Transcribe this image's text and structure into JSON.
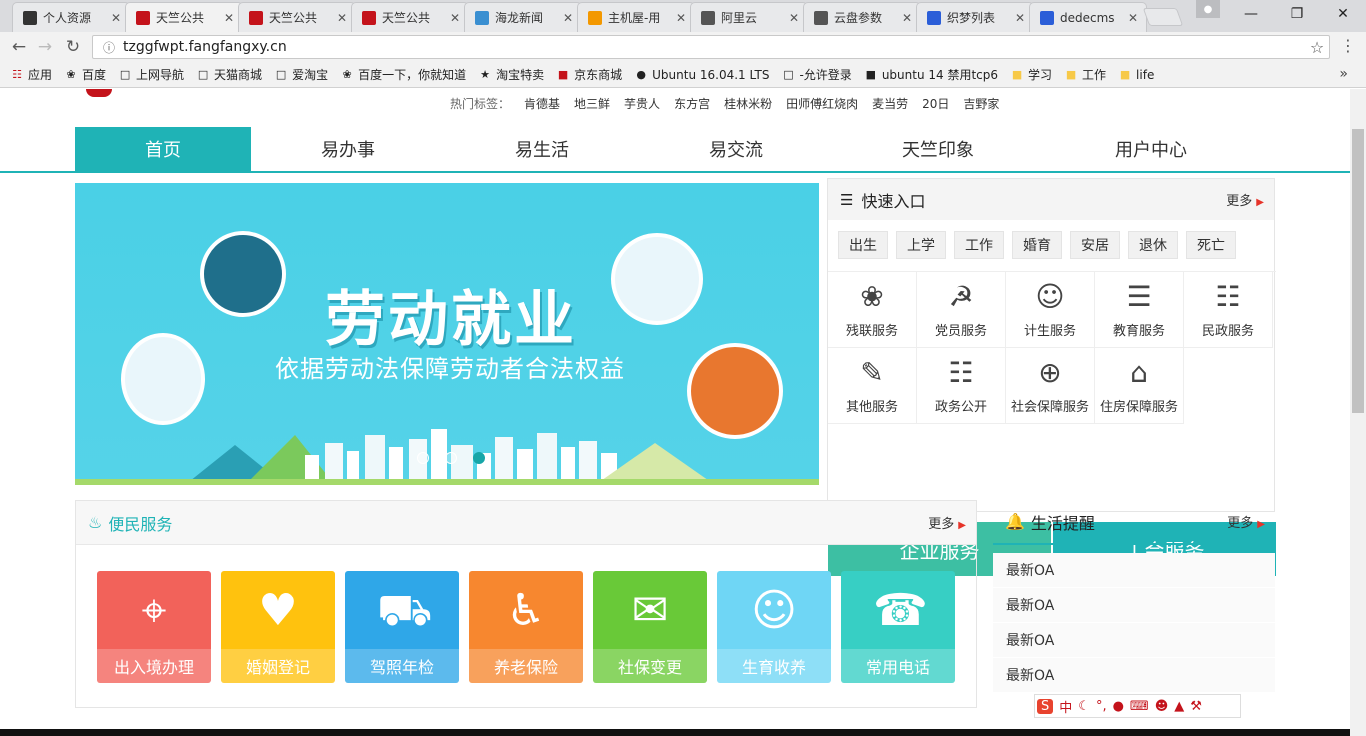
{
  "browser": {
    "tabs": [
      {
        "title": "个人资源",
        "icon": "m-icon",
        "color": "#333333"
      },
      {
        "title": "天竺公共",
        "icon": "tianzhu-icon",
        "color": "#c4131b"
      },
      {
        "title": "天竺公共",
        "icon": "tianzhu-icon",
        "color": "#c4131b"
      },
      {
        "title": "天竺公共",
        "icon": "tianzhu-icon",
        "color": "#c4131b"
      },
      {
        "title": "海龙新闻",
        "icon": "hailong-icon",
        "color": "#3a8fd1"
      },
      {
        "title": "主机屋-用",
        "icon": "house-icon",
        "color": "#f39800"
      },
      {
        "title": "阿里云",
        "icon": "cloud-icon",
        "color": "#555555"
      },
      {
        "title": "云盘参数",
        "icon": "cloud-icon",
        "color": "#555555"
      },
      {
        "title": "织梦列表",
        "icon": "paw-icon",
        "color": "#2b5ed8"
      },
      {
        "title": "dedecms",
        "icon": "paw-icon",
        "color": "#2b5ed8"
      }
    ],
    "url": "tzggfwpt.fangfangxy.cn",
    "bookmarks": [
      "应用",
      "百度",
      "上网导航",
      "天猫商城",
      "爱淘宝",
      "百度一下，你就知道",
      "淘宝特卖",
      "京东商城",
      "Ubuntu 16.04.1 LTS",
      "-允许登录",
      "ubuntu 14 禁用tcp6",
      "学习",
      "工作",
      "life"
    ]
  },
  "header": {
    "hot_label": "热门标签：",
    "hot_tags": [
      "肯德基",
      "地三鲜",
      "芋贵人",
      "东方宫",
      "桂林米粉",
      "田师傅红烧肉",
      "麦当劳",
      "20日",
      "吉野家"
    ]
  },
  "nav": [
    "首页",
    "易办事",
    "易生活",
    "易交流",
    "天竺印象",
    "用户中心"
  ],
  "banner": {
    "title": "劳动就业",
    "subtitle": "依据劳动法保障劳动者合法权益",
    "slides": 3,
    "active_slide": 3
  },
  "quick": {
    "title": "快速入口",
    "more": "更多",
    "tags": [
      "出生",
      "上学",
      "工作",
      "婚育",
      "安居",
      "退休",
      "死亡"
    ],
    "services": [
      "残联服务",
      "党员服务",
      "计生服务",
      "教育服务",
      "民政服务",
      "其他服务",
      "政务公开",
      "社会保障服务",
      "住房保障服务"
    ],
    "enterprise": "企业服务",
    "union": "工会服务"
  },
  "convenience": {
    "title": "便民服务",
    "more": "更多",
    "cards": [
      {
        "label": "出入境办理",
        "color": "#f2625a"
      },
      {
        "label": "婚姻登记",
        "color": "#ffc20e"
      },
      {
        "label": "驾照年检",
        "color": "#2fa7e8"
      },
      {
        "label": "养老保险",
        "color": "#f7872f"
      },
      {
        "label": "社保变更",
        "color": "#69c938"
      },
      {
        "label": "生育收养",
        "color": "#6fd6f5"
      },
      {
        "label": "常用电话",
        "color": "#37cfc4"
      }
    ]
  },
  "life": {
    "title": "生活提醒",
    "more": "更多",
    "items": [
      "最新OA",
      "最新OA",
      "最新OA",
      "最新OA"
    ]
  },
  "ime": {
    "label": "中"
  },
  "colors": {
    "accent": "#1fb3b6",
    "enterprise": "#3dbfa3",
    "union": "#1fb3b6"
  }
}
